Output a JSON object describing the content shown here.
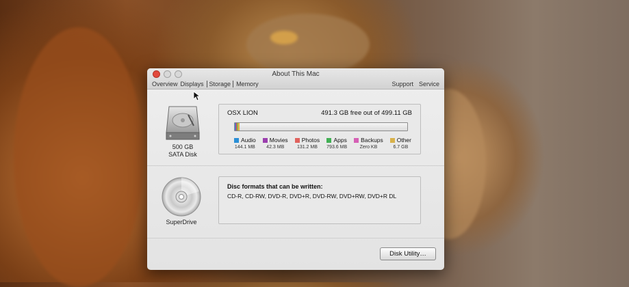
{
  "window": {
    "title": "About This Mac",
    "tabs": [
      "Overview",
      "Displays",
      "Storage",
      "Memory"
    ],
    "selected_tab": "Storage",
    "right_links": [
      "Support",
      "Service"
    ]
  },
  "hard_disk": {
    "icon": "hard-drive-icon",
    "size_label": "500 GB",
    "type_label": "SATA Disk",
    "volume_name": "OSX LION",
    "free_text": "491.3 GB free out of 499.11 GB",
    "used_fraction": 0.016,
    "categories": [
      {
        "name": "Audio",
        "size": "144.1 MB",
        "color": "#2a8fd6",
        "fraction": 0.0003
      },
      {
        "name": "Movies",
        "size": "42.3 MB",
        "color": "#9b3fae",
        "fraction": 0.0001
      },
      {
        "name": "Photos",
        "size": "131.2 MB",
        "color": "#e0625d",
        "fraction": 0.0003
      },
      {
        "name": "Apps",
        "size": "793.6 MB",
        "color": "#41b054",
        "fraction": 0.0016
      },
      {
        "name": "Backups",
        "size": "Zero KB",
        "color": "#d660b5",
        "fraction": 0.0
      },
      {
        "name": "Other",
        "size": "6.7 GB",
        "color": "#d8b14a",
        "fraction": 0.0134
      }
    ]
  },
  "optical": {
    "icon": "disc-icon",
    "label": "SuperDrive",
    "formats_title": "Disc formats that can be written:",
    "formats": "CD-R, CD-RW, DVD-R, DVD+R, DVD-RW, DVD+RW, DVD+R DL"
  },
  "buttons": {
    "disk_utility": "Disk Utility…"
  }
}
